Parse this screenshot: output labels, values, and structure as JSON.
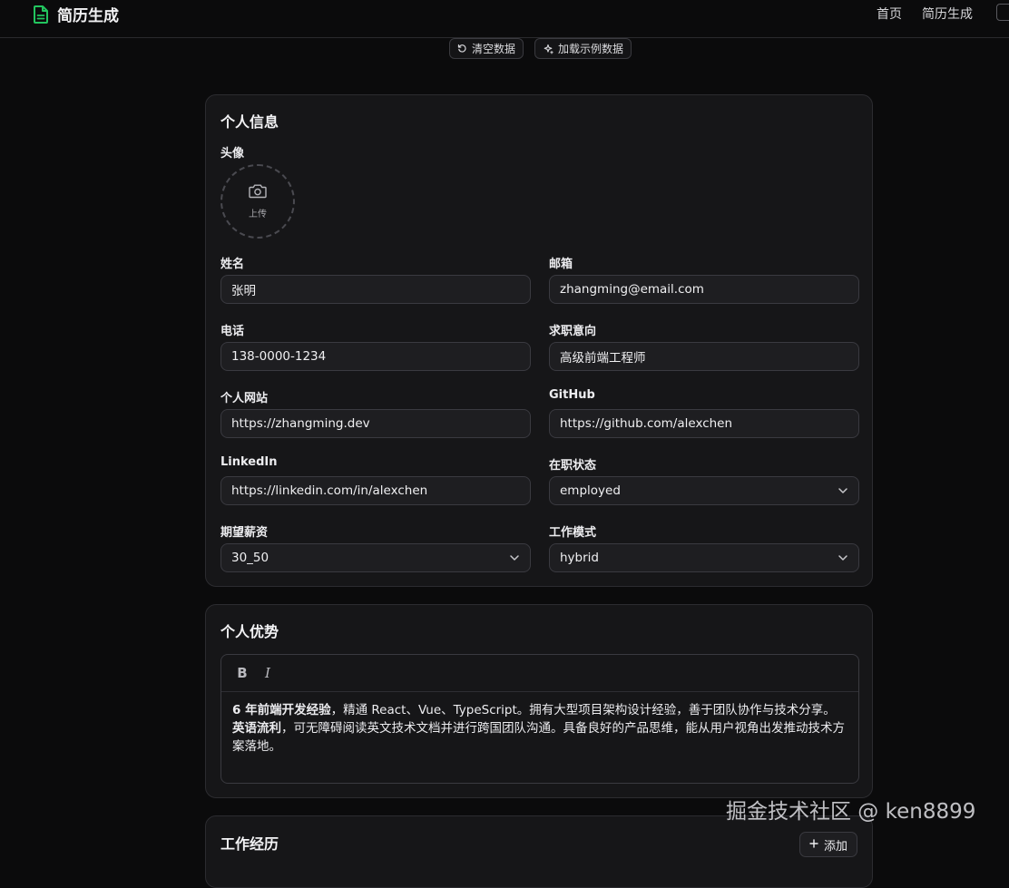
{
  "header": {
    "brand_icon": "file-text-icon",
    "brand_color": "#22c55e",
    "title": "简历生成",
    "nav": [
      "首页",
      "简历生成"
    ]
  },
  "actions": {
    "clear_label": "清空数据",
    "clear_icon": "rotate-ccw-icon",
    "load_label": "加载示例数据",
    "load_icon": "sparkles-icon"
  },
  "personal": {
    "title": "个人信息",
    "avatar_label": "头像",
    "avatar_icon": "camera-icon",
    "upload_text": "上传",
    "fields": {
      "name": {
        "label": "姓名",
        "value": "张明"
      },
      "email": {
        "label": "邮箱",
        "value": "zhangming@email.com"
      },
      "phone": {
        "label": "电话",
        "value": "138-0000-1234"
      },
      "job_intent": {
        "label": "求职意向",
        "value": "高级前端工程师"
      },
      "website": {
        "label": "个人网站",
        "value": "https://zhangming.dev"
      },
      "github": {
        "label": "GitHub",
        "value": "https://github.com/alexchen"
      },
      "linkedin": {
        "label": "LinkedIn",
        "value": "https://linkedin.com/in/alexchen"
      },
      "status": {
        "label": "在职状态",
        "value": "employed"
      },
      "salary": {
        "label": "期望薪资",
        "value": "30_50"
      },
      "work_mode": {
        "label": "工作模式",
        "value": "hybrid"
      }
    }
  },
  "strengths": {
    "title": "个人优势",
    "toolbar": {
      "bold": "B",
      "italic": "I"
    },
    "content": {
      "part1_bold": "6 年前端开发经验",
      "part2": "，精通 React、Vue、TypeScript。拥有大型项目架构设计经验，善于团队协作与技术分享。",
      "part3_bold": "英语流利",
      "part4": "，可无障碍阅读英文技术文档并进行跨国团队沟通。具备良好的产品思维，能从用户视角出发推动技术方案落地。"
    }
  },
  "experience": {
    "title": "工作经历",
    "add_label": "添加",
    "add_icon": "plus-icon"
  },
  "watermark": "掘金技术社区 @ ken8899"
}
